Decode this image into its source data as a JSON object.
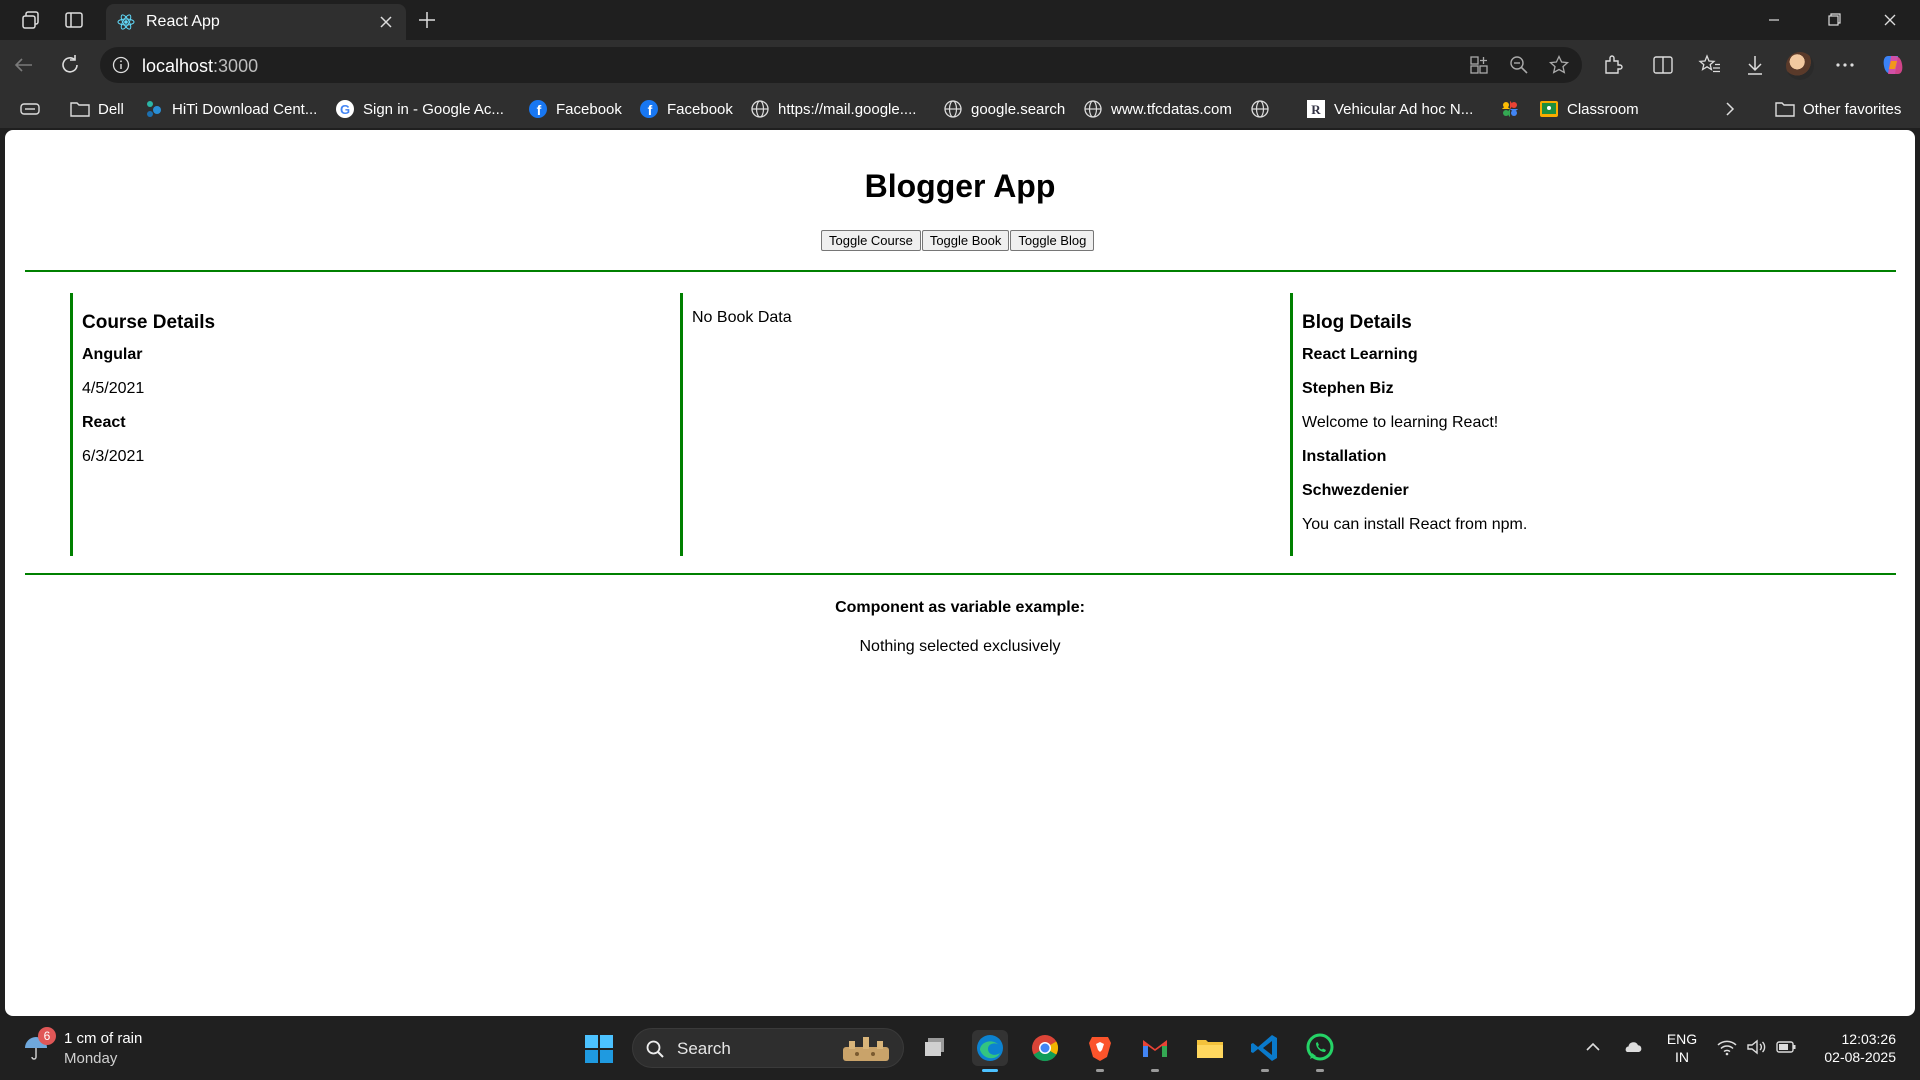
{
  "browser": {
    "tab_title": "React App",
    "url_host": "localhost",
    "url_rest": ":3000"
  },
  "bookmarks": [
    {
      "label": "Dell",
      "icon": "folder-icon"
    },
    {
      "label": "HiTi Download Cent...",
      "icon": "hiti-icon"
    },
    {
      "label": "Sign in - Google Ac...",
      "icon": "google-icon"
    },
    {
      "label": "Facebook",
      "icon": "facebook-icon"
    },
    {
      "label": "Facebook",
      "icon": "facebook-icon"
    },
    {
      "label": "https://mail.google....",
      "icon": "globe-icon"
    },
    {
      "label": "google.search",
      "icon": "globe-icon"
    },
    {
      "label": "www.tfcdatas.com",
      "icon": "globe-icon"
    },
    {
      "label": "Vehicular Ad hoc N...",
      "icon": "r-icon"
    },
    {
      "label": "Classroom",
      "icon": "classroom-icon"
    },
    {
      "label": "Other favorites",
      "icon": "folder-icon"
    }
  ],
  "page": {
    "title": "Blogger App",
    "buttons": [
      "Toggle Course",
      "Toggle Book",
      "Toggle Blog"
    ],
    "course": {
      "heading": "Course Details",
      "items": [
        {
          "name": "Angular",
          "date": "4/5/2021"
        },
        {
          "name": "React",
          "date": "6/3/2021"
        }
      ]
    },
    "book": {
      "empty_text": "No Book Data"
    },
    "blog": {
      "heading": "Blog Details",
      "items": [
        {
          "title": "React Learning",
          "author": "Stephen Biz",
          "content": "Welcome to learning React!"
        },
        {
          "title": "Installation",
          "author": "Schwezdenier",
          "content": "You can install React from npm."
        }
      ]
    },
    "footer": {
      "label": "Component as variable example:",
      "text": "Nothing selected exclusively"
    }
  },
  "taskbar": {
    "weather_badge": "6",
    "weather_text": "1 cm of rain",
    "weather_day": "Monday",
    "search_label": "Search",
    "lang_1": "ENG",
    "lang_2": "IN",
    "time": "12:03:26",
    "date": "02-08-2025"
  },
  "colors": {
    "accent_green": "#008000",
    "browser_dark": "#1f1f1f",
    "toolbar": "#2f2f2f"
  }
}
